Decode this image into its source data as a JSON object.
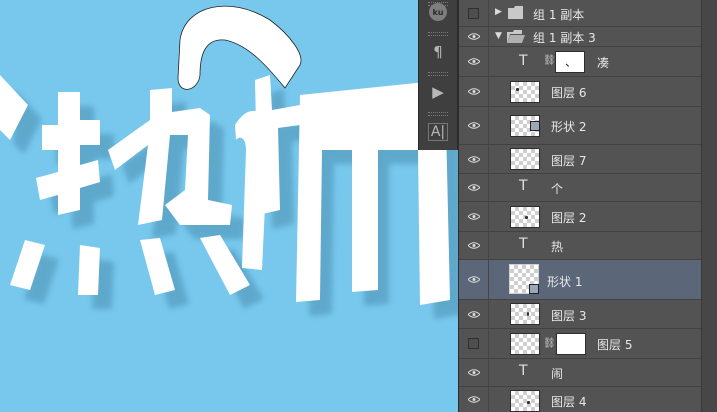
{
  "canvas": {
    "background": "#78c8ee",
    "char_1": "热",
    "char_2": "闹"
  },
  "toolstrip": {
    "items": [
      {
        "icon": "ku-plugin-icon",
        "label": "ku"
      },
      {
        "icon": "paragraph-icon",
        "label": "¶"
      },
      {
        "icon": "play-actions-icon",
        "label": "▶"
      },
      {
        "icon": "character-panel-icon",
        "label": "A|"
      }
    ]
  },
  "layers": [
    {
      "type": "group",
      "name": "组 1 副本",
      "visible": false,
      "expanded": false
    },
    {
      "type": "group",
      "name": "组 1 副本 3",
      "visible": true,
      "expanded": true
    },
    {
      "type": "text",
      "name": "、 凑",
      "prefix": "T",
      "visible": true,
      "linked_mask": true,
      "mask_text": "、",
      "label": "凑"
    },
    {
      "type": "pixel",
      "name": "图层 6",
      "visible": true
    },
    {
      "type": "shape",
      "name": "形状 2",
      "visible": true
    },
    {
      "type": "pixel",
      "name": "图层 7",
      "visible": true
    },
    {
      "type": "text",
      "name": "个",
      "prefix": "T",
      "visible": true
    },
    {
      "type": "pixel",
      "name": "图层 2",
      "visible": true
    },
    {
      "type": "text",
      "name": "热",
      "prefix": "T",
      "visible": true
    },
    {
      "type": "shape",
      "name": "形状 1",
      "visible": true,
      "selected": true
    },
    {
      "type": "pixel",
      "name": "图层 3",
      "visible": true
    },
    {
      "type": "pixel",
      "name": "图层 5",
      "visible": false,
      "linked_mask": true
    },
    {
      "type": "text",
      "name": "闹",
      "prefix": "T",
      "visible": true
    },
    {
      "type": "pixel",
      "name": "图层 4",
      "visible": true
    }
  ]
}
